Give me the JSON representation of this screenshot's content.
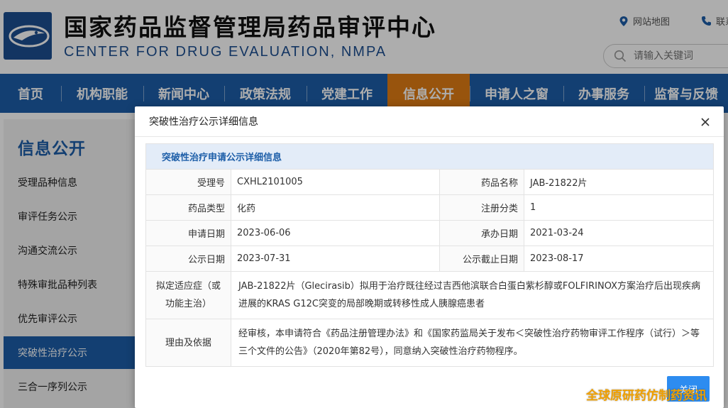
{
  "header": {
    "title_cn": "国家药品监督管理局药品审评中心",
    "title_en": "CENTER FOR DRUG EVALUATION, NMPA",
    "sitemap_label": "网站地图",
    "contact_label": "联系",
    "search_placeholder": "请输入关键词"
  },
  "nav": {
    "items": [
      {
        "label": "首页"
      },
      {
        "label": "机构职能"
      },
      {
        "label": "新闻中心"
      },
      {
        "label": "政策法规"
      },
      {
        "label": "党建工作"
      },
      {
        "label": "信息公开",
        "active": true
      },
      {
        "label": "申请人之窗"
      },
      {
        "label": "办事服务"
      },
      {
        "label": "监督与反馈"
      }
    ]
  },
  "sidebar": {
    "title": "信息公开",
    "items": [
      {
        "label": "受理品种信息"
      },
      {
        "label": "审评任务公示"
      },
      {
        "label": "沟通交流公示"
      },
      {
        "label": "特殊审批品种列表"
      },
      {
        "label": "优先审评公示"
      },
      {
        "label": "突破性治疗公示",
        "active": true
      },
      {
        "label": "三合一序列公示"
      }
    ]
  },
  "modal": {
    "title": "突破性治疗公示详细信息",
    "table_caption": "突破性治疗申请公示详细信息",
    "fields": {
      "accept_no_label": "受理号",
      "accept_no": "CXHL2101005",
      "drug_name_label": "药品名称",
      "drug_name": "JAB-21822片",
      "drug_type_label": "药品类型",
      "drug_type": "化药",
      "reg_class_label": "注册分类",
      "reg_class": "1",
      "apply_date_label": "申请日期",
      "apply_date": "2023-06-06",
      "undertake_date_label": "承办日期",
      "undertake_date": "2021-03-24",
      "publish_date_label": "公示日期",
      "publish_date": "2023-07-31",
      "deadline_label": "公示截止日期",
      "deadline": "2023-08-17",
      "indication_label": "拟定适应症（或功能主治）",
      "indication": "JAB-21822片（Glecirasib）拟用于治疗既往经过吉西他滨联合白蛋白紫杉醇或FOLFIRINOX方案治疗后出现疾病进展的KRAS G12C突变的局部晚期或转移性成人胰腺癌患者",
      "reason_label": "理由及依据",
      "reason": "经审核，本申请符合《药品注册管理办法》和《国家药监局关于发布＜突破性治疗药物审评工作程序（试行）＞等三个文件的公告》（2020年第82号），同意纳入突破性治疗药物程序。"
    },
    "confirm_label": "关闭"
  },
  "watermark": "全球原研药仿制药资讯",
  "colors": {
    "nav_bg": "#1d5ea8",
    "nav_active": "#e07c14",
    "caption_bg": "#e3ecf8",
    "button": "#2d8cf0",
    "watermark": "#f0a000"
  }
}
